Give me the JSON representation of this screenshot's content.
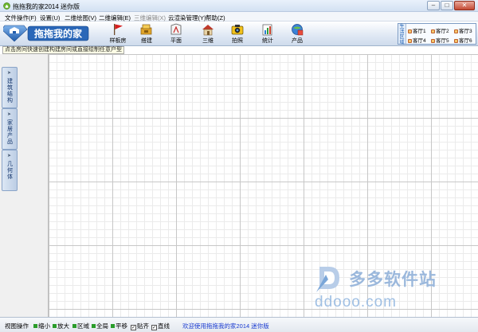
{
  "window": {
    "title": "拖拖我的家2014 迷你版",
    "buttons": [
      "–",
      "□",
      "✕"
    ]
  },
  "menu": [
    {
      "label": "文件操作(F)",
      "disabled": false
    },
    {
      "label": "设置(U)",
      "disabled": false
    },
    {
      "label": "二维绘图(V)",
      "disabled": false
    },
    {
      "label": "二维编辑(E)",
      "disabled": false
    },
    {
      "label": "三维编辑(X)",
      "disabled": true
    },
    {
      "label": "云渲染管理(Y)",
      "disabled": false
    },
    {
      "label": "帮助(Z)",
      "disabled": false
    }
  ],
  "logo": {
    "text": "拖拖我的家"
  },
  "toolbar": {
    "buttons": [
      {
        "label": "样板房",
        "icon": "flag-icon"
      },
      {
        "label": "搭建",
        "icon": "build-icon"
      },
      {
        "label": "平面",
        "icon": "plan-icon"
      },
      {
        "label": "三维",
        "icon": "house-3d-icon"
      },
      {
        "label": "拍照",
        "icon": "camera-icon"
      },
      {
        "label": "统计",
        "icon": "stats-icon"
      },
      {
        "label": "产品",
        "icon": "product-icon"
      }
    ]
  },
  "rooms": {
    "label": "生活 区域",
    "items": [
      "客厅1",
      "客厅2",
      "客厅3",
      "客厅4",
      "客厅5",
      "客厅6"
    ]
  },
  "hint": "点击房间快速创建构建房间或直接绘制任意户型",
  "side_tabs": [
    "建筑结构",
    "家居产品",
    "几何体"
  ],
  "watermark": {
    "brand": "多多软件站",
    "url": "ddooo.com"
  },
  "status": {
    "view_label": "视图操作",
    "items": [
      {
        "label": "缩小"
      },
      {
        "label": "放大"
      },
      {
        "label": "区域"
      },
      {
        "label": "全局"
      },
      {
        "label": "平移"
      }
    ],
    "checks": [
      {
        "label": "贴齐",
        "checked": true
      },
      {
        "label": "直线",
        "checked": true
      }
    ],
    "welcome": "欢迎使用拖拖我的家2014 迷你版"
  },
  "colors": {
    "accent": "#1d5fb3",
    "welcome_text": "#1a3bd0",
    "grid_major": "#c7c7c7",
    "grid_minor": "#ebebeb",
    "watermark": "#9bb8dc"
  }
}
